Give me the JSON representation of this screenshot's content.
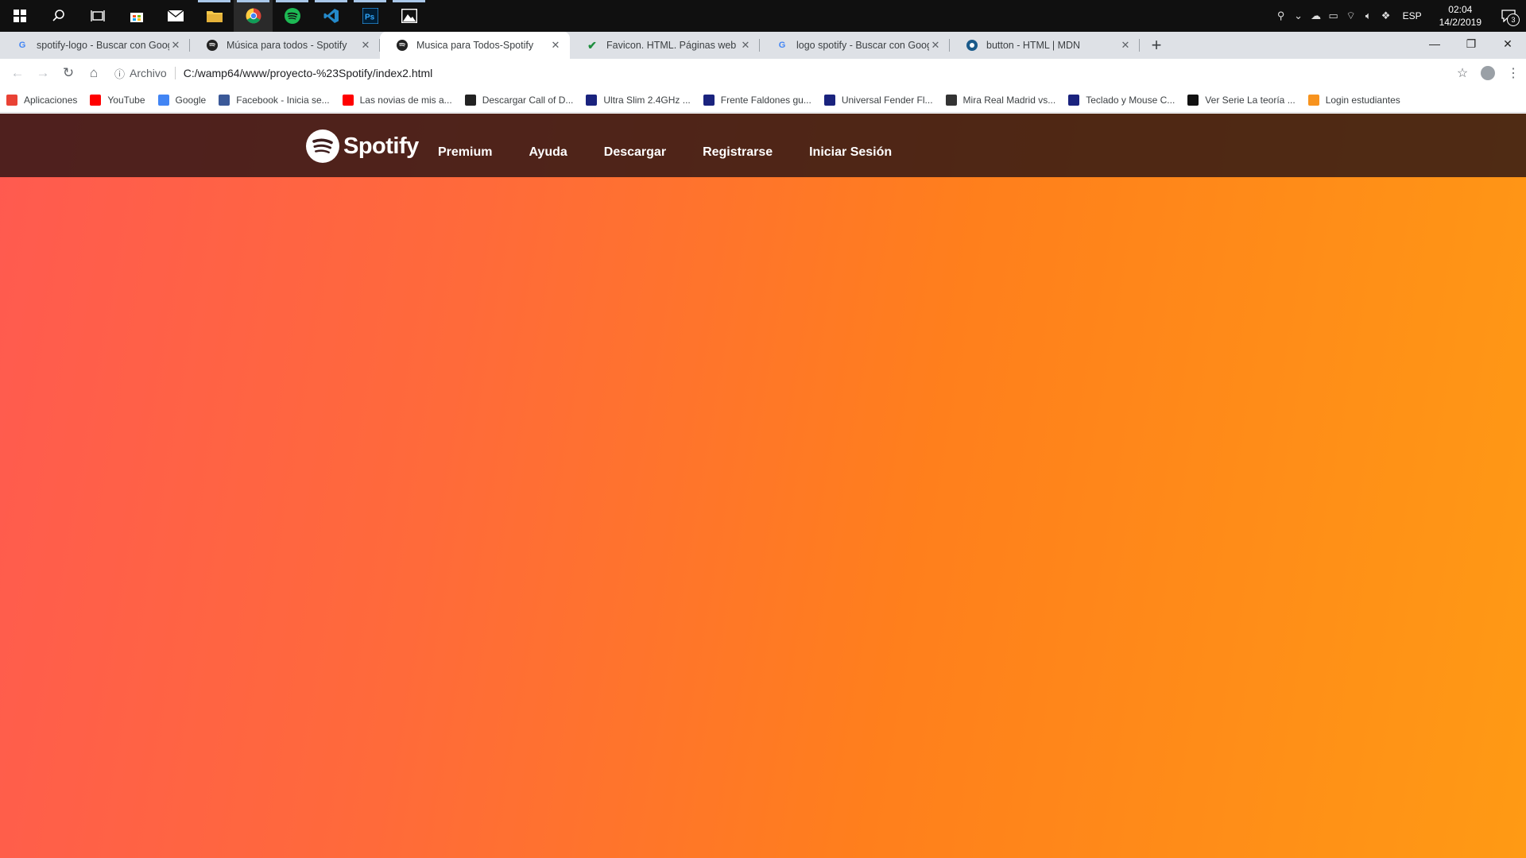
{
  "taskbar": {
    "apps": [
      {
        "icon": "windows-start-icon"
      },
      {
        "icon": "search-icon"
      },
      {
        "icon": "task-view-icon"
      },
      {
        "icon": "store-icon"
      },
      {
        "icon": "mail-icon"
      },
      {
        "icon": "file-explorer-icon"
      },
      {
        "icon": "chrome-icon"
      },
      {
        "icon": "spotify-icon"
      },
      {
        "icon": "vscode-icon"
      },
      {
        "icon": "photoshop-icon"
      },
      {
        "icon": "photos-icon"
      }
    ],
    "language": "ESP",
    "time": "02:04",
    "date": "14/2/2019",
    "notification_count": "3"
  },
  "browser": {
    "tabs": [
      {
        "title": "spotify-logo - Buscar con Google",
        "favicon": "google-icon",
        "active": false
      },
      {
        "title": "Música para todos - Spotify",
        "favicon": "spotify-icon",
        "active": false
      },
      {
        "title": "Musica para Todos-Spotify",
        "favicon": "spotify-icon",
        "active": true
      },
      {
        "title": "Favicon. HTML. Páginas web HTM",
        "favicon": "checkmark-icon",
        "active": false
      },
      {
        "title": "logo spotify - Buscar con Google",
        "favicon": "google-icon",
        "active": false
      },
      {
        "title": "button - HTML | MDN",
        "favicon": "mdn-icon",
        "active": false
      }
    ],
    "omnibox": {
      "label": "Archivo",
      "url": "C:/wamp64/www/proyecto-%23Spotify/index2.html"
    },
    "bookmarks": [
      {
        "label": "Aplicaciones",
        "icon": "apps-grid-icon",
        "color": "#e94235"
      },
      {
        "label": "YouTube",
        "icon": "youtube-icon",
        "color": "#ff0000"
      },
      {
        "label": "Google",
        "icon": "google-icon",
        "color": "#4285f4"
      },
      {
        "label": "Facebook - Inicia se...",
        "icon": "facebook-icon",
        "color": "#3b5998"
      },
      {
        "label": "Las novias de mis a...",
        "icon": "youtube-icon",
        "color": "#ff0000"
      },
      {
        "label": "Descargar Call of D...",
        "icon": "game-icon",
        "color": "#222222"
      },
      {
        "label": "Ultra Slim 2.4GHz ...",
        "icon": "shop-icon",
        "color": "#1a237e"
      },
      {
        "label": "Frente Faldones gu...",
        "icon": "shop-icon",
        "color": "#1a237e"
      },
      {
        "label": "Universal Fender Fl...",
        "icon": "shop-icon",
        "color": "#1a237e"
      },
      {
        "label": "Mira Real Madrid vs...",
        "icon": "video-icon",
        "color": "#333333"
      },
      {
        "label": "Teclado y Mouse C...",
        "icon": "shop-icon",
        "color": "#1a237e"
      },
      {
        "label": "Ver Serie La teoría ...",
        "icon": "p-icon",
        "color": "#111111"
      },
      {
        "label": "Login estudiantes",
        "icon": "moodle-icon",
        "color": "#f7931e"
      }
    ]
  },
  "spotify": {
    "brand": "Spotify",
    "nav": [
      "Premium",
      "Ayuda",
      "Descargar",
      "Registrarse",
      "Iniciar Sesión"
    ]
  }
}
